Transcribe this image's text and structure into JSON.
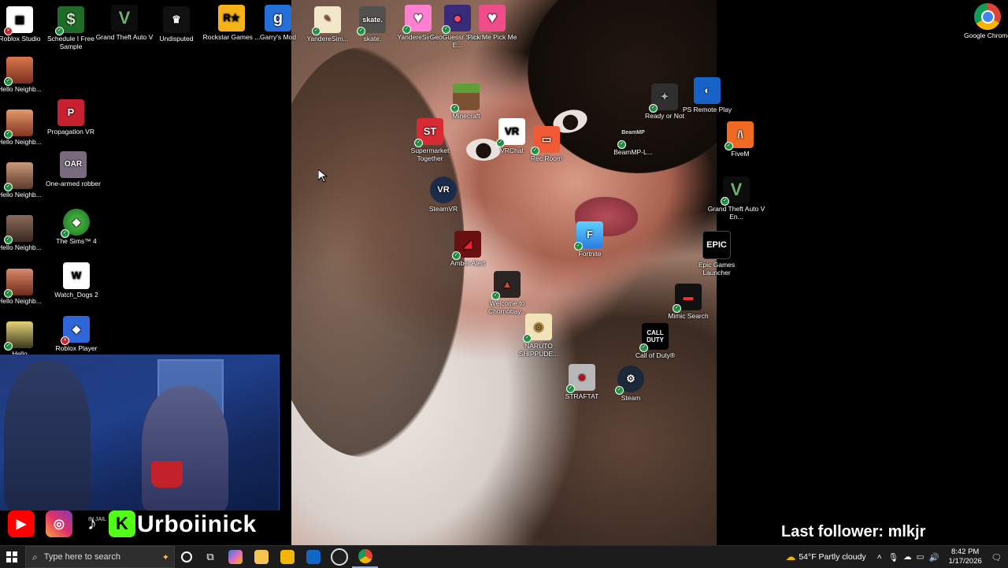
{
  "desktop_icons": {
    "roblox_studio": "Roblox Studio",
    "schedule_i": "Schedule I Free Sample",
    "gta5": "Grand Theft Auto V",
    "undisputed": "Undisputed",
    "rockstar": "Rockstar Games ...",
    "garrys_mod": "Garry's Mod",
    "yandere_sim_1": "YandereSim...",
    "skate": "skate.",
    "yandere_sim_2": "YandereSim...",
    "geoguessr": "GeoGuessr Steam E...",
    "pick_me": "Pick Me Pick Me",
    "google_chrome": "Google Chrome",
    "hello_neighbor": "Hello Neighb...",
    "hello_short": "Hello",
    "propagation_vr": "Propagation VR",
    "one_armed_robber": "One-armed robber",
    "the_sims_4": "The Sims™ 4",
    "watch_dogs_2": "Watch_Dogs 2",
    "roblox_player": "Roblox Player",
    "minecraft": "Minecraft",
    "supermarket_together": "Supermarket Together",
    "vrchat": "VRChat",
    "rec_room": "Rec Room",
    "steamvr": "SteamVR",
    "amber_alert": "Amber Alert",
    "welcome_chornobay": "Welcome to Chornobay...",
    "naruto": "NARUTO SHIPPUDE...",
    "straftat": "STRAFTAT",
    "steam": "Steam",
    "fortnite": "Fortnite",
    "call_of_duty": "Call of Duty®",
    "mimic_search": "Mimic Search",
    "ready_or_not": "Ready or Not",
    "beammp": "BeamMP-L...",
    "ps_remote_play": "PS Remote Play",
    "fivem": "FiveM",
    "gta5_enhanced": "Grand Theft Auto V En...",
    "epic_games": "Epic Games Launcher"
  },
  "overlay": {
    "brand_name": "Urboiinick",
    "last_follower": "Last follower: mlkjr",
    "tiktok_small_text": "IN JAIL"
  },
  "taskbar": {
    "search_placeholder": "Type here to search",
    "weather": "54°F  Partly cloudy",
    "time": "8:42 PM",
    "date": "1/17/2026"
  },
  "colors": {
    "taskbar_bg": "#1c1c1c",
    "webcam_tint": "#1f3f8a",
    "check_badge": "#1e9d43"
  }
}
